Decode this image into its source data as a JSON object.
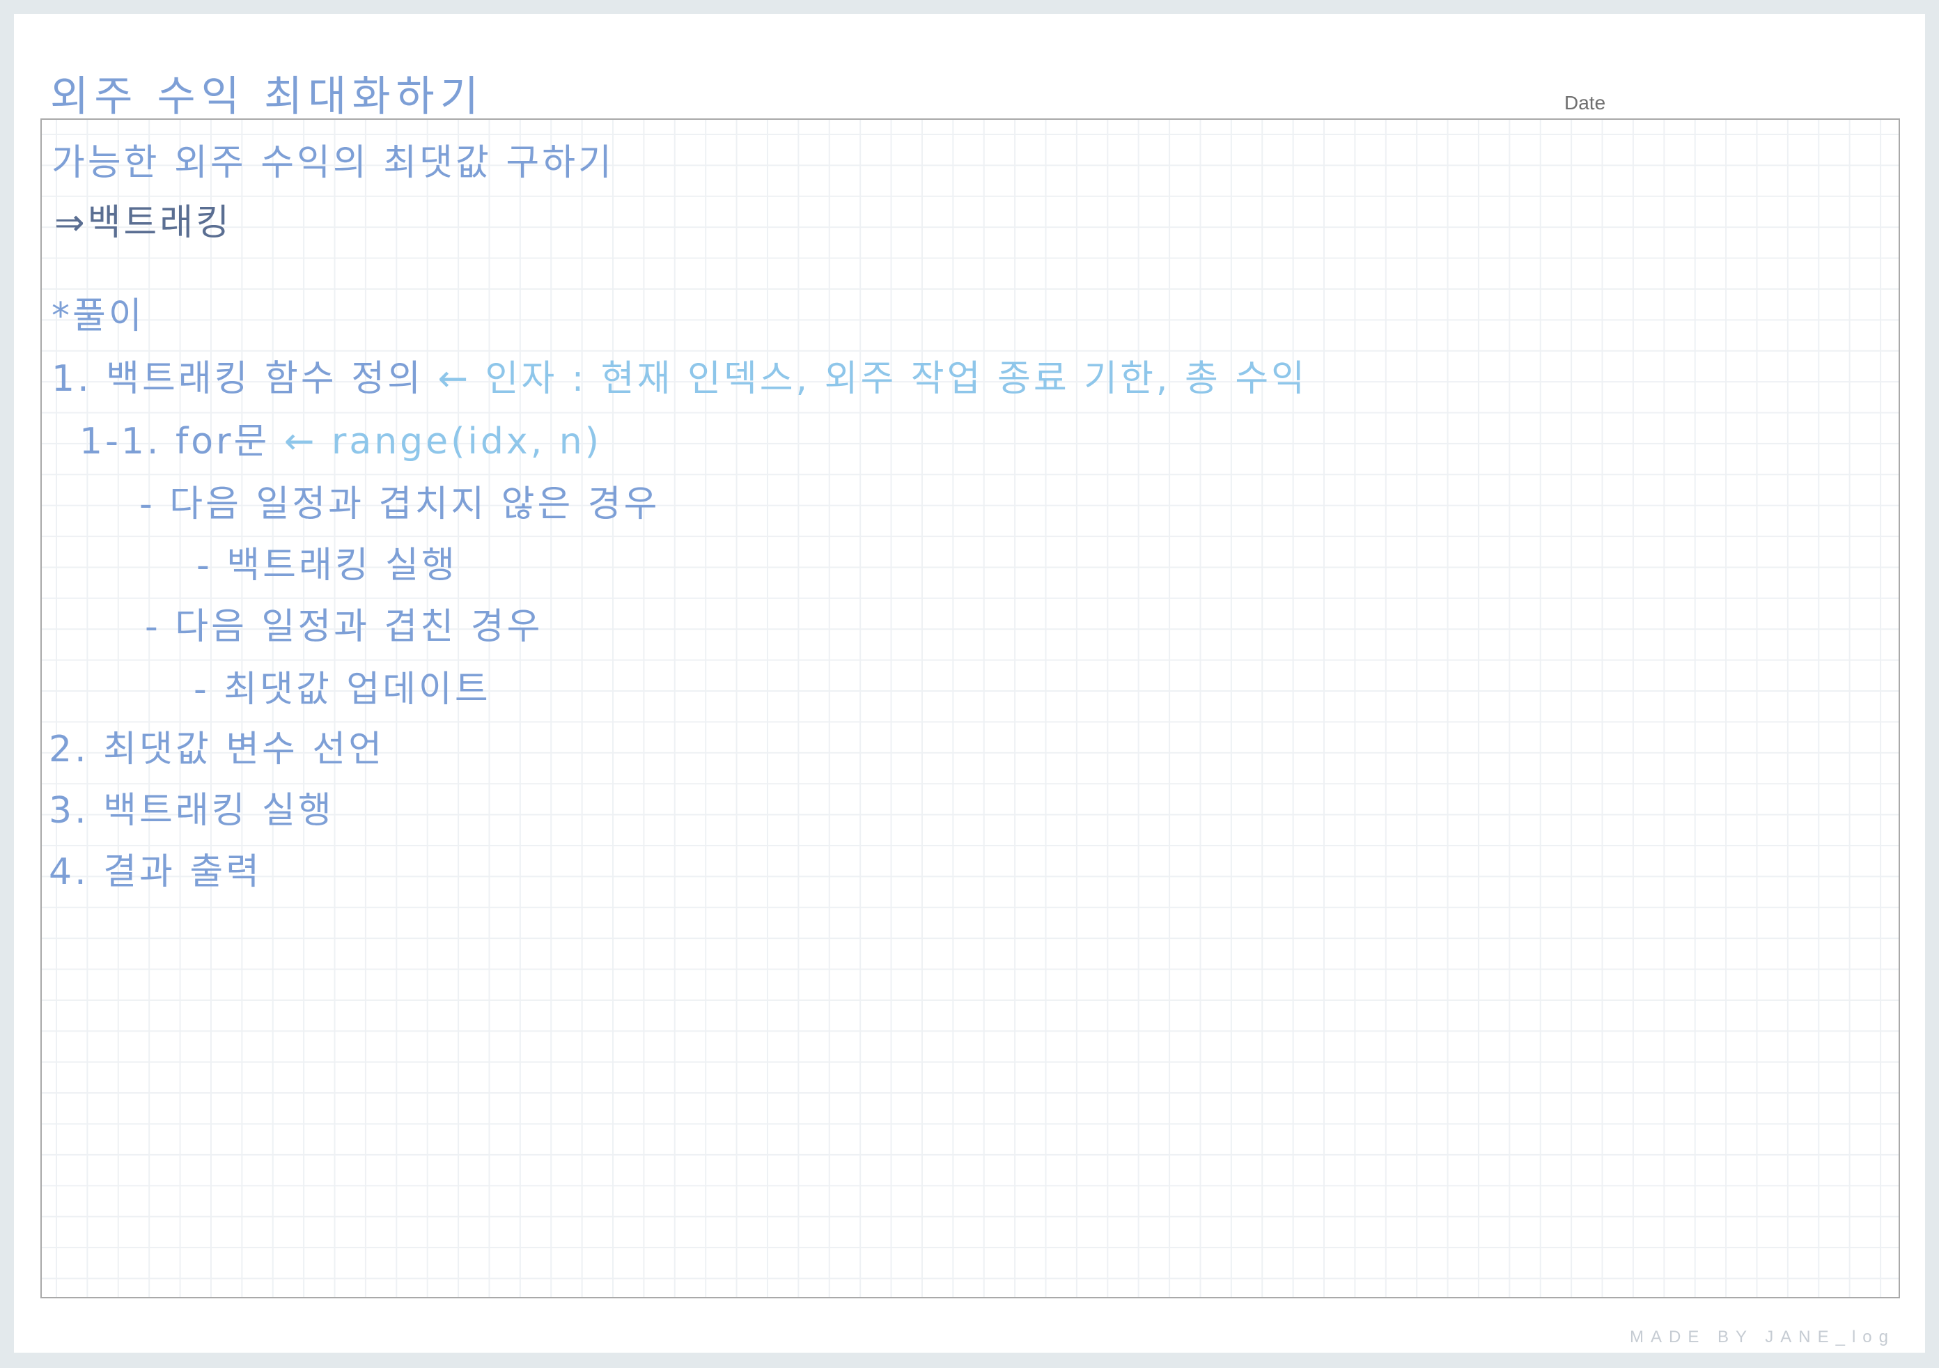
{
  "header": {
    "title": "외주 수익 최대화하기",
    "date_label": "Date"
  },
  "notes": {
    "line1": "가능한 외주 수익의 최댓값 구하기",
    "line2": "⇒백트래킹",
    "line3": "*풀이",
    "line4_main": "1. 백트래킹 함수 정의",
    "line4_note": "← 인자 : 현재 인덱스, 외주 작업 종료 기한, 총 수익",
    "line5_main": "1-1. for문",
    "line5_note": "← range(idx, n)",
    "line6": "- 다음 일정과 겹치지 않은 경우",
    "line7": "- 백트래킹 실행",
    "line8": "- 다음 일정과 겹친 경우",
    "line9": "- 최댓값 업데이트",
    "line10": "2. 최댓값 변수 선언",
    "line11": "3. 백트래킹 실행",
    "line12": "4. 결과 출력"
  },
  "footer": {
    "credit": "MADE BY JANE_log"
  },
  "colors": {
    "ink_blue": "#7d9fd6",
    "ink_dark": "#5a6e92",
    "ink_light": "#8ec6ea",
    "grid_line": "#eef1f4",
    "border": "#a9a9a9",
    "background": "#e3e9ec"
  }
}
